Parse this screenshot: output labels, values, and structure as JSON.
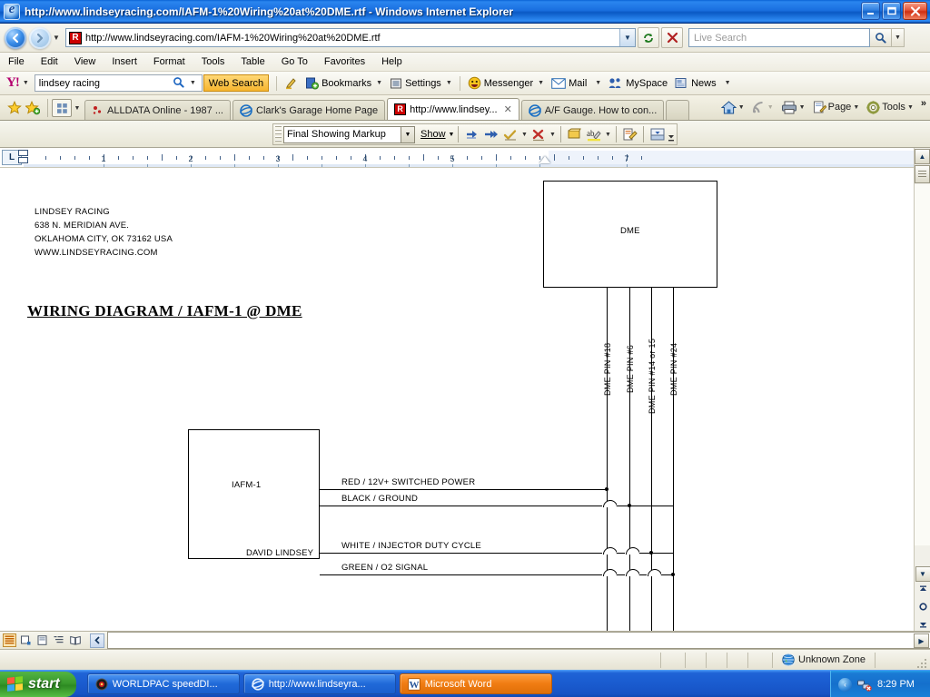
{
  "window": {
    "title": "http://www.lindseyracing.com/IAFM-1%20Wiring%20at%20DME.rtf - Windows Internet Explorer",
    "minimize_label": "_",
    "maximize_label": "❐",
    "close_label": "✕"
  },
  "address_bar": {
    "url": "http://www.lindseyracing.com/IAFM-1%20Wiring%20at%20DME.rtf",
    "search_placeholder": "Live Search",
    "back_tooltip": "Back",
    "forward_tooltip": "Forward"
  },
  "menu": {
    "items": [
      "File",
      "Edit",
      "View",
      "Insert",
      "Format",
      "Tools",
      "Table",
      "Go To",
      "Favorites",
      "Help"
    ]
  },
  "yahoo_toolbar": {
    "logo": "Y!",
    "search_value": "lindsey racing",
    "search_button": "Web Search",
    "bookmarks": "Bookmarks",
    "settings": "Settings",
    "messenger": "Messenger",
    "mail": "Mail",
    "myspace": "MySpace",
    "news": "News"
  },
  "tabs": {
    "items": [
      {
        "label": "ALLDATA Online - 1987 ...",
        "icon": "alldata-icon",
        "active": false
      },
      {
        "label": "Clark's Garage Home Page",
        "icon": "ie-icon",
        "active": false
      },
      {
        "label": "http://www.lindsey...",
        "icon": "rtf-icon",
        "active": true,
        "close": "✕"
      },
      {
        "label": "A/F Gauge. How to con...",
        "icon": "ie-icon",
        "active": false
      }
    ],
    "toolbar": {
      "home": "Home",
      "feeds": "Feeds",
      "print": "Print",
      "page": "Page",
      "tools": "Tools",
      "overflow": "»"
    }
  },
  "reviewing_toolbar": {
    "display_mode": "Final Showing Markup",
    "show_label": "Show",
    "buttons": [
      "previous-change",
      "next-change",
      "accept-change",
      "reject-change",
      "new-comment",
      "highlight",
      "reviewing-pane",
      "track-changes"
    ]
  },
  "ruler": {
    "tab_stop": "L",
    "marks": [
      "1",
      "2",
      "3",
      "4",
      "5",
      "6",
      "7"
    ],
    "right_margin_mark": "7"
  },
  "document": {
    "address_block": [
      "LINDSEY RACING",
      "638 N. MERIDIAN AVE.",
      "OKLAHOMA CITY, OK 73162 USA",
      "WWW.LINDSEYRACING.COM"
    ],
    "title": "WIRING DIAGRAM / IAFM-1 @ DME",
    "dme_box_label": "DME",
    "device_box_label": "IAFM-1",
    "author_label": "DAVID LINDSEY",
    "wire_labels": [
      "RED / 12V+ SWITCHED POWER",
      "BLACK /  GROUND",
      "WHITE / INJECTOR DUTY CYCLE",
      "GREEN / O2 SIGNAL"
    ],
    "pin_labels": [
      "DME PIN #18",
      "DME PIN #6",
      "DME PIN #14 or 15",
      "DME PIN #24"
    ]
  },
  "word_status": {
    "view_buttons": [
      "normal-view",
      "web-layout-view",
      "print-layout-view",
      "outline-view",
      "reading-layout-view"
    ]
  },
  "ie_status": {
    "zone": "Unknown Zone",
    "zone_icon": "globe-icon"
  },
  "taskbar": {
    "start_label": "start",
    "items": [
      {
        "label": "WORLDPAC speedDI...",
        "icon": "worldpac-icon",
        "active": false
      },
      {
        "label": "http://www.lindseyra...",
        "icon": "ie-icon",
        "active": false
      },
      {
        "label": "Microsoft Word",
        "icon": "word-icon",
        "active": true
      }
    ],
    "clock": "8:29 PM",
    "tray_arrow": "‹"
  },
  "colors": {
    "title_blue": "#1a6fe0",
    "taskbar_blue": "#1a5cd0",
    "start_green": "#399a2c",
    "word_orange": "#f07c12",
    "yahoo_purple": "#b4006e",
    "websearch_gold": "#f7b52e"
  }
}
